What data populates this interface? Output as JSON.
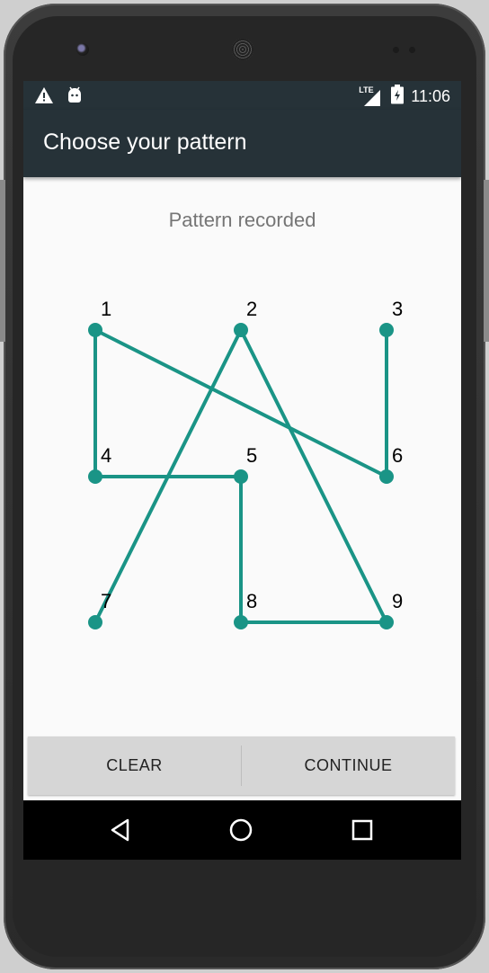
{
  "status_bar": {
    "network_label": "LTE",
    "clock": "11:06",
    "left_icons": [
      "warning-icon",
      "android-icon"
    ],
    "right_icons": [
      "signal-icon",
      "battery-icon"
    ]
  },
  "app_bar": {
    "title": "Choose your pattern"
  },
  "pattern": {
    "message": "Pattern recorded",
    "dots": [
      {
        "label": "1"
      },
      {
        "label": "2"
      },
      {
        "label": "3"
      },
      {
        "label": "4"
      },
      {
        "label": "5"
      },
      {
        "label": "6"
      },
      {
        "label": "7"
      },
      {
        "label": "8"
      },
      {
        "label": "9"
      }
    ],
    "sequence": [
      3,
      6,
      1,
      4,
      5,
      8,
      9,
      2,
      7
    ],
    "accent_color": "#1a9486"
  },
  "buttons": {
    "clear": "CLEAR",
    "continue": "CONTINUE"
  },
  "nav_bar": {
    "icons": [
      "back-icon",
      "home-icon",
      "recents-icon"
    ]
  }
}
